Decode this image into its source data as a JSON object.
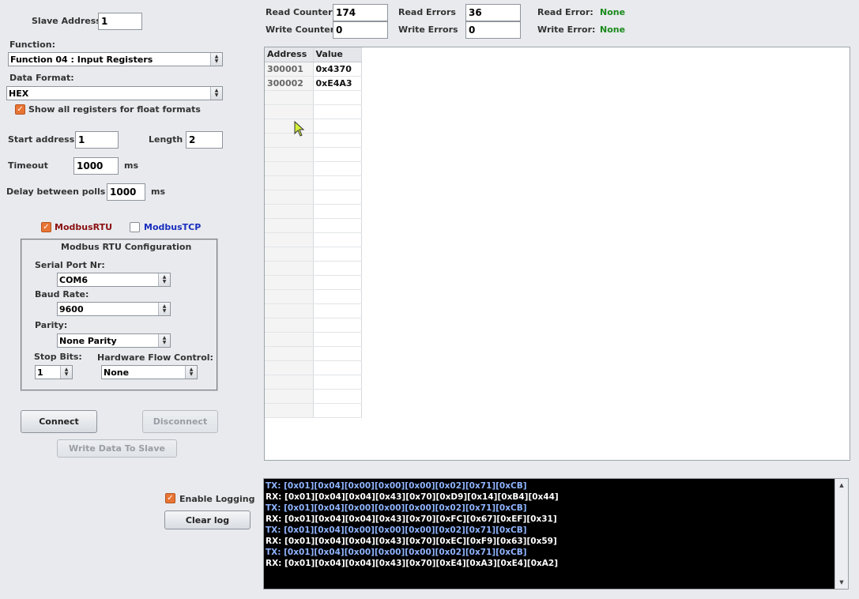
{
  "slave_address": {
    "label": "Slave Address",
    "value": "1"
  },
  "function": {
    "label": "Function:",
    "value": "Function 04 : Input Registers"
  },
  "data_format": {
    "label": "Data Format:",
    "value": "HEX"
  },
  "show_all_registers": {
    "label": "Show all registers for float formats",
    "checked": true
  },
  "start_address": {
    "label": "Start address",
    "value": "1"
  },
  "length": {
    "label": "Length",
    "value": "2"
  },
  "timeout": {
    "label": "Timeout",
    "value": "1000",
    "unit": "ms"
  },
  "delay_polls": {
    "label": "Delay between polls",
    "value": "1000",
    "unit": "ms"
  },
  "modbus_rtu": {
    "label": "ModbusRTU",
    "checked": true
  },
  "modbus_tcp": {
    "label": "ModbusTCP",
    "checked": false
  },
  "rtu_config": {
    "title": "Modbus RTU Configuration",
    "serial_port": {
      "label": "Serial Port Nr:",
      "value": "COM6"
    },
    "baud_rate": {
      "label": "Baud Rate:",
      "value": "9600"
    },
    "parity": {
      "label": "Parity:",
      "value": "None Parity"
    },
    "stop_bits": {
      "label": "Stop Bits:",
      "value": "1"
    },
    "flow_control": {
      "label": "Hardware Flow Control:",
      "value": "None"
    }
  },
  "buttons": {
    "connect": "Connect",
    "disconnect": "Disconnect",
    "write_data": "Write Data To Slave",
    "clear_log": "Clear log"
  },
  "enable_logging": {
    "label": "Enable Logging",
    "checked": true
  },
  "counters": {
    "read_counter": {
      "label": "Read Counter",
      "value": "174"
    },
    "write_counter": {
      "label": "Write Counter",
      "value": "0"
    },
    "read_errors": {
      "label": "Read Errors",
      "value": "36"
    },
    "write_errors": {
      "label": "Write Errors",
      "value": "0"
    },
    "read_error": {
      "label": "Read Error:",
      "value": "None"
    },
    "write_error": {
      "label": "Write Error:",
      "value": "None"
    }
  },
  "register_table": {
    "columns": [
      "Address",
      "Value"
    ],
    "rows": [
      {
        "address": "300001",
        "value": "0x4370"
      },
      {
        "address": "300002",
        "value": "0xE4A3"
      }
    ]
  },
  "log": [
    {
      "type": "tx",
      "text": "TX: [0x01][0x04][0x00][0x00][0x00][0x02][0x71][0xCB]"
    },
    {
      "type": "rx",
      "text": "RX: [0x01][0x04][0x04][0x43][0x70][0xD9][0x14][0xB4][0x44]"
    },
    {
      "type": "tx",
      "text": "TX: [0x01][0x04][0x00][0x00][0x00][0x02][0x71][0xCB]"
    },
    {
      "type": "rx",
      "text": "RX: [0x01][0x04][0x04][0x43][0x70][0xFC][0x67][0xEF][0x31]"
    },
    {
      "type": "tx",
      "text": "TX: [0x01][0x04][0x00][0x00][0x00][0x02][0x71][0xCB]"
    },
    {
      "type": "rx",
      "text": "RX: [0x01][0x04][0x04][0x43][0x70][0xEC][0xF9][0x63][0x59]"
    },
    {
      "type": "tx",
      "text": "TX: [0x01][0x04][0x00][0x00][0x00][0x02][0x71][0xCB]"
    },
    {
      "type": "rx",
      "text": "RX: [0x01][0x04][0x04][0x43][0x70][0xE4][0xA3][0xE4][0xA2]"
    }
  ]
}
